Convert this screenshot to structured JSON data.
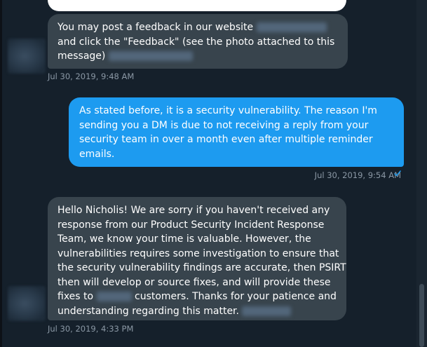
{
  "messages": [
    {
      "lines": [
        "You may post a feedback in our website",
        "and click the \"Feedback\" (see the photo attached to this",
        "message)"
      ],
      "timestamp": "Jul 30, 2019, 9:48 AM"
    },
    {
      "lines": [
        "As stated before, it is a security vulnerability. The reason I'm",
        "sending you a DM is due to not receiving a reply from your",
        "security team in over a month even after multiple reminder",
        "emails."
      ],
      "timestamp": "Jul 30, 2019, 9:54 AM",
      "read_icon": "checkmark-icon"
    },
    {
      "lines": [
        "Hello Nicholis! We are sorry if you haven't received any",
        "response from our Product Security Incident Response",
        "Team, we know your time is valuable. However, the",
        "vulnerabilities requires some  investigation to ensure that",
        "the security vulnerability findings are accurate, then PSIRT",
        "then will develop or source fixes, and will provide these",
        "fixes to",
        "customers. Thanks for your patience and",
        "understanding regarding this matter."
      ],
      "timestamp": "Jul 30, 2019, 4:33 PM"
    }
  ],
  "colors": {
    "background": "#15202b",
    "incoming_bubble": "#38444d",
    "outgoing_bubble": "#1d9bf0",
    "timestamp": "#8b98a5"
  },
  "icons": {
    "read_receipt": "checkmark-icon"
  }
}
